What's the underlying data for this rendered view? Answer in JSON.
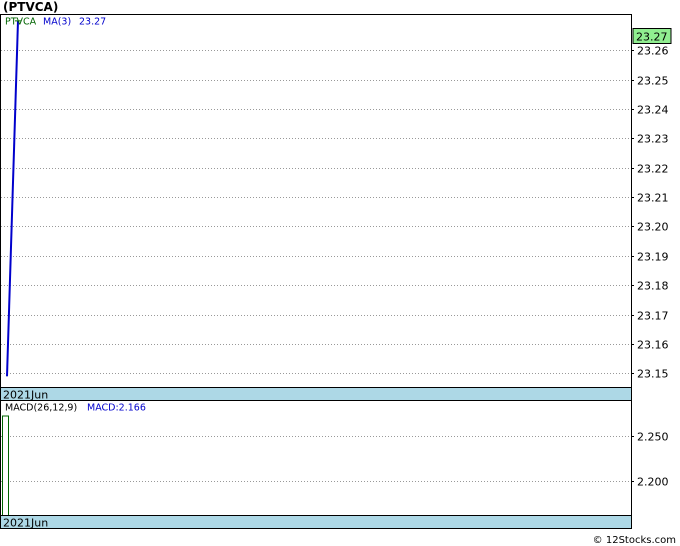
{
  "header": {
    "title": "(PTVCA)"
  },
  "footer": {
    "credit": "© 12Stocks.com"
  },
  "chart_data": [
    {
      "type": "line",
      "series": [
        {
          "name": "PTVCA",
          "color": "#006400",
          "x": [
            "2021Jun-a",
            "2021Jun-b"
          ],
          "values": [
            23.149,
            23.27
          ]
        },
        {
          "name": "MA(3)",
          "color": "#0000cc",
          "x": [
            "2021Jun-a",
            "2021Jun-b"
          ],
          "values": [
            23.149,
            23.27
          ]
        }
      ],
      "legend": {
        "ticker": "PTVCA",
        "ma_label": "MA(3)",
        "ma_value": "23.27"
      },
      "last_value_label": "23.27",
      "xlabel_band": "2021Jun",
      "ylim": [
        23.145,
        23.272
      ],
      "yticks": [
        "23.26",
        "23.25",
        "23.24",
        "23.23",
        "23.22",
        "23.21",
        "23.20",
        "23.19",
        "23.18",
        "23.17",
        "23.16",
        "23.15"
      ],
      "ytick_values": [
        23.26,
        23.25,
        23.24,
        23.23,
        23.22,
        23.21,
        23.2,
        23.19,
        23.18,
        23.17,
        23.16,
        23.15
      ],
      "grid": true
    },
    {
      "type": "bar",
      "series": [
        {
          "name": "MACD",
          "values": [
            2.166
          ]
        }
      ],
      "legend": {
        "params": "MACD(26,12,9)",
        "macd_label": "MACD:2.166"
      },
      "xlabel_band": "2021Jun",
      "ylim": [
        2.16,
        2.29
      ],
      "yticks": [
        "2.250",
        "2.200"
      ],
      "ytick_values": [
        2.25,
        2.2
      ],
      "grid": true
    }
  ]
}
